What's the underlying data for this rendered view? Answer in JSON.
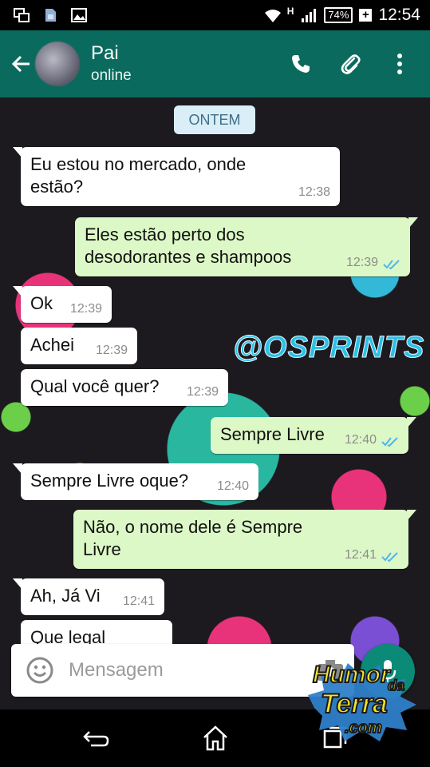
{
  "status_bar": {
    "network_type": "H",
    "battery": "74%",
    "time": "12:54"
  },
  "header": {
    "contact_name": "Pai",
    "contact_status": "online"
  },
  "chat": {
    "date_separator": "ONTEM",
    "watermark": "@OSPRINTS",
    "messages": [
      {
        "dir": "in",
        "text_lines": [
          "Eu estou no mercado, onde",
          "estão?"
        ],
        "time": "12:38"
      },
      {
        "dir": "out",
        "text_lines": [
          "Eles estão perto dos",
          "desodorantes e shampoos"
        ],
        "time": "12:39",
        "status": "read"
      },
      {
        "dir": "in",
        "text_lines": [
          "Ok"
        ],
        "time": "12:39"
      },
      {
        "dir": "in",
        "text_lines": [
          "Achei"
        ],
        "time": "12:39"
      },
      {
        "dir": "in",
        "text_lines": [
          "Qual você quer?"
        ],
        "time": "12:39"
      },
      {
        "dir": "out",
        "text_lines": [
          "Sempre Livre"
        ],
        "time": "12:40",
        "status": "read"
      },
      {
        "dir": "in",
        "text_lines": [
          "Sempre Livre oque?"
        ],
        "time": "12:40"
      },
      {
        "dir": "out",
        "text_lines": [
          "Não, o nome dele é Sempre",
          "Livre"
        ],
        "time": "12:41",
        "status": "read"
      },
      {
        "dir": "in",
        "text_lines": [
          "Ah, Já Vi"
        ],
        "time": "12:41"
      },
      {
        "dir": "in",
        "text_lines": [
          "Que legal"
        ],
        "time": "",
        "partially_hidden": true
      }
    ]
  },
  "composer": {
    "placeholder": "Mensagem"
  },
  "logo": {
    "line1": "Humor",
    "line2": "da",
    "line3": "Terra",
    "line4": ".com"
  },
  "colors": {
    "app_bar": "#0b6a5e",
    "outgoing_bubble": "#dcf8c6",
    "incoming_bubble": "#ffffff",
    "read_ticks": "#4fb6ec",
    "fab": "#0b8a78"
  }
}
